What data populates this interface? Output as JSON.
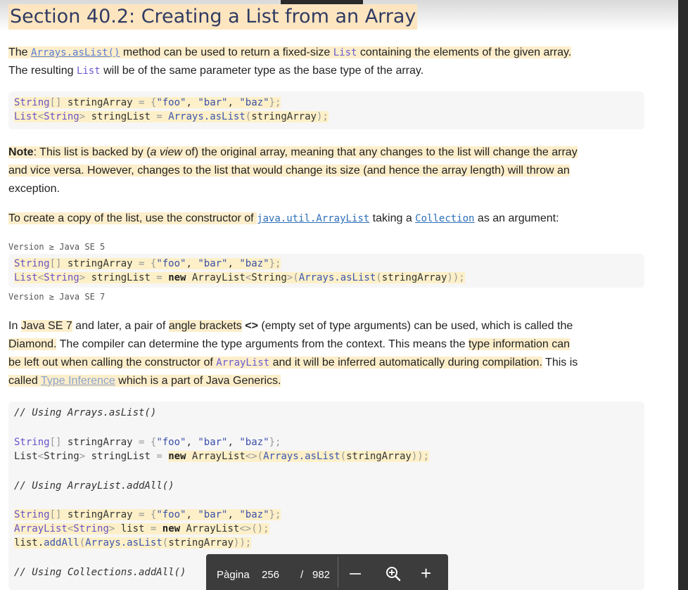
{
  "heading": "Section 40.2: Creating a List from an Array",
  "para1": {
    "t1": "The ",
    "link": "Arrays.asList()",
    "t2": " method can be used to return a fixed-size ",
    "code1": "List",
    "t3": " containing the elements of the given array.",
    "line2a": "The resulting ",
    "code2": "List",
    "line2b": " will be of the same parameter type as the base type of the array."
  },
  "code1": {
    "line1": "String[] stringArray = {\"foo\", \"bar\", \"baz\"};",
    "line2": "List<String> stringList = Arrays.asList(stringArray);"
  },
  "note": {
    "bold": "Note",
    "l1a": ": This list is backed by (",
    "l1b": "a view",
    "l1c": " of) the original array, meaning that any changes to the list will change the array",
    "l2": "and vice versa. However, changes to the list that would change its size (and hence the array length) will throw an",
    "l3": "exception."
  },
  "para_copy": {
    "t1": "To create a copy of the list, use the constructor of ",
    "code1": "java.util.ArrayList",
    "t2": " taking a ",
    "code2": "Collection",
    "t3": " as an argument:"
  },
  "version1": "Version ≥ Java SE 5",
  "code2": {
    "line1": "String[] stringArray = {\"foo\", \"bar\", \"baz\"};",
    "line2": "List<String> stringList = new ArrayList<String>(Arrays.asList(stringArray));"
  },
  "version2": "Version ≥ Java SE 7",
  "para_diamond": {
    "l1a": "In ",
    "l1b": "Java SE 7",
    "l1c": " and later, a pair of ",
    "l1d": "angle brackets",
    "l1e": " ",
    "l1f": "<>",
    "l1g": " (empty set of type arguments) can be used, which is called the",
    "l2a": "Diamond.",
    "l2b": " The compiler can determine the type arguments from the context. This means the ",
    "l2c": "type information can",
    "l3a": "be left out when calling the constructor of ",
    "l3b": "ArrayList",
    "l3c": " and it will be inferred automatically during compilation.",
    "l3d": " This is",
    "l4a": "called ",
    "l4b": "Type Inference",
    "l4c": " which is a part of Java Generics."
  },
  "code3": {
    "c1": "// Using Arrays.asList()",
    "l1": "String[] stringArray = {\"foo\", \"bar\", \"baz\"};",
    "l2": "List<String> stringList = new ArrayList<>(Arrays.asList(stringArray));",
    "c2": "// Using ArrayList.addAll()",
    "l3": "String[] stringArray = {\"foo\", \"bar\", \"baz\"};",
    "l4": "ArrayList<String> list = new ArrayList<>();",
    "l5": "list.addAll(Arrays.asList(stringArray));",
    "c3": "// Using Collections.addAll()"
  },
  "pager": {
    "label": "Pàgina",
    "current": "256",
    "separator": "/",
    "total": "982",
    "zoom_out_icon": "minus-icon",
    "zoom_icon": "zoom-in-icon",
    "zoom_in_icon": "plus-icon"
  }
}
